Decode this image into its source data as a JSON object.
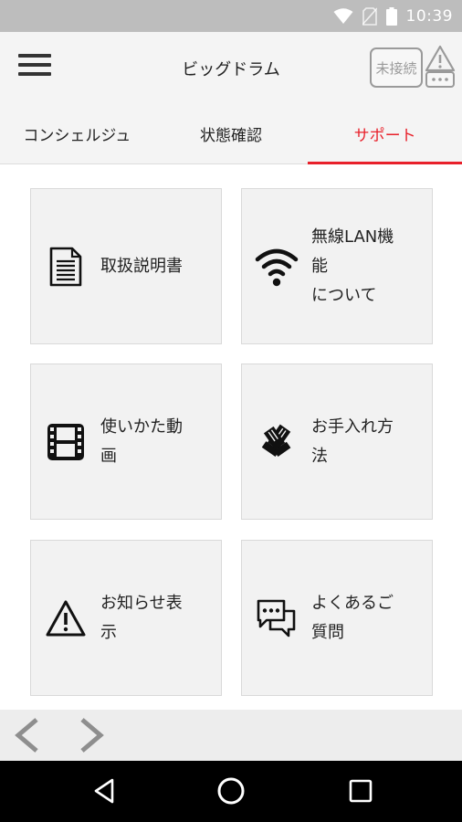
{
  "status_bar": {
    "time": "10:39",
    "icons": [
      "wifi-icon",
      "no-sim-icon",
      "battery-icon"
    ]
  },
  "app_bar": {
    "title": "ビッグドラム",
    "connection_status": "未接続"
  },
  "tabs": [
    {
      "label": "コンシェルジュ",
      "active": false
    },
    {
      "label": "状態確認",
      "active": false
    },
    {
      "label": "サポート",
      "active": true
    }
  ],
  "menu": [
    {
      "label": "取扱説明書",
      "icon": "document-icon"
    },
    {
      "label": "無線LAN機\n能\nについて",
      "icon": "wifi-icon"
    },
    {
      "label": "使いかた動\n画",
      "icon": "film-icon"
    },
    {
      "label": "お手入れ方\n法",
      "icon": "gloves-icon"
    },
    {
      "label": "お知らせ表\n示",
      "icon": "warning-icon"
    },
    {
      "label": "よくあるご\n質問",
      "icon": "chat-bubbles-icon"
    }
  ],
  "colors": {
    "accent": "#e8202a",
    "card_bg": "#f2f2f2",
    "status_bar": "#bdbdbd"
  }
}
